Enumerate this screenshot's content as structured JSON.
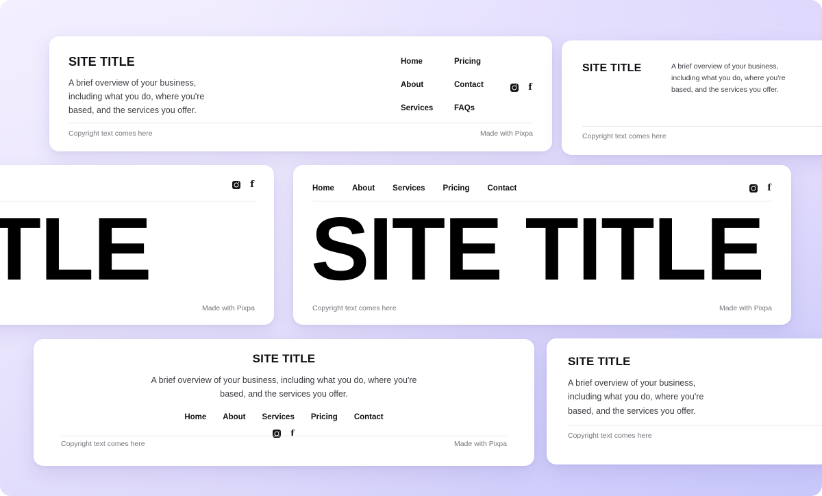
{
  "background": {
    "gradient_from": "#f3efff",
    "gradient_mid": "#ded8fd",
    "gradient_to": "#c9c8fb"
  },
  "common": {
    "site_title": "SITE TITLE",
    "description": "A brief overview of your business, including what you do, where you're based, and the services you offer.",
    "copyright": "Copyright text comes here",
    "made_with": "Made with Pixpa",
    "instagram_icon": "instagram-icon",
    "facebook_icon": "facebook-icon",
    "facebook_glyph": "f"
  },
  "cards": {
    "top_left": {
      "title": "SITE TITLE",
      "description": "A brief overview of your business, including what you do, where you're based, and the services you offer.",
      "nav": [
        {
          "label": "Home"
        },
        {
          "label": "Pricing"
        },
        {
          "label": "About"
        },
        {
          "label": "Contact"
        },
        {
          "label": "Services"
        },
        {
          "label": "FAQs"
        }
      ],
      "copyright": "Copyright text comes here",
      "made_with": "Made with Pixpa"
    },
    "top_right": {
      "title": "SITE TITLE",
      "description": "A brief overview of your business, including what you do, where you're based, and the services you offer.",
      "copyright": "Copyright text comes here"
    },
    "mid_left": {
      "big_title": "TITLE",
      "made_with": "Made with Pixpa"
    },
    "mid_center": {
      "big_title": "SITE TITLE",
      "nav": [
        {
          "label": "Home"
        },
        {
          "label": "About"
        },
        {
          "label": "Services"
        },
        {
          "label": "Pricing"
        },
        {
          "label": "Contact"
        }
      ],
      "copyright": "Copyright text comes here",
      "made_with": "Made with Pixpa"
    },
    "bot_center": {
      "title": "SITE TITLE",
      "description": "A brief overview of your business, including what you do, where you're based, and the services you offer.",
      "nav": [
        {
          "label": "Home"
        },
        {
          "label": "About"
        },
        {
          "label": "Services"
        },
        {
          "label": "Pricing"
        },
        {
          "label": "Contact"
        }
      ],
      "copyright": "Copyright text comes here",
      "made_with": "Made with Pixpa"
    },
    "bot_right": {
      "title": "SITE TITLE",
      "description": "A brief overview of your business, including what you do, where you're based, and the services you offer.",
      "copyright": "Copyright text comes here"
    }
  }
}
